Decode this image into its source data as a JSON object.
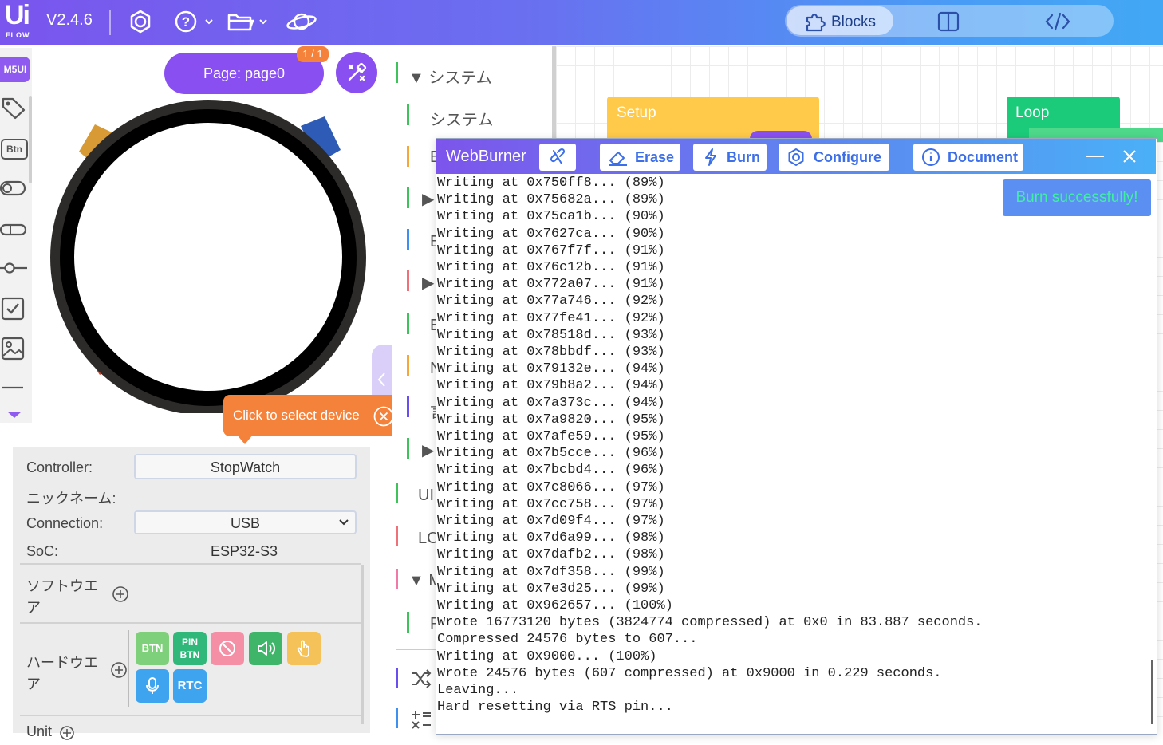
{
  "app": {
    "logo_text": "Ui",
    "logo_sub": "FLOW",
    "version": "V2.4.6",
    "mode_tabs": {
      "blocks": "Blocks"
    }
  },
  "toolbox": {
    "header": "M5UI",
    "btn_label": "Btn"
  },
  "preview": {
    "page_label": "Page: page0",
    "page_count": "1 / 1",
    "tooltip": "Click to select device"
  },
  "properties": {
    "controller_label": "Controller:",
    "controller_value": "StopWatch",
    "nickname_label": "ニックネーム:",
    "connection_label": "Connection:",
    "connection_value": "USB",
    "soc_label": "SoC:",
    "soc_value": "ESP32-S3",
    "software_label_1": "ソフトウエ",
    "software_label_2": "ア",
    "hardware_label_1": "ハードウエ",
    "hardware_label_2": "ア",
    "unit_label": "Unit",
    "hardware_items": [
      {
        "label": "BTN",
        "color": "#7fd07a"
      },
      {
        "label": "PIN BTN",
        "color": "#2fb87a"
      },
      {
        "label": "",
        "icon": "no-touch-icon",
        "color": "#f58fa5"
      },
      {
        "label": "",
        "icon": "speaker-icon",
        "color": "#3fb56a"
      },
      {
        "label": "",
        "icon": "touch-icon",
        "color": "#f5c25a"
      },
      {
        "label": "",
        "icon": "microphone-icon",
        "color": "#3fa4f0"
      },
      {
        "label": "RTC",
        "color": "#3fa4f0"
      }
    ]
  },
  "categories": [
    {
      "label": "▼ システム",
      "color": "#3fc25a"
    },
    {
      "label": "システム",
      "color": "#3fc25a"
    },
    {
      "label": "B",
      "color": "#f5a73a"
    },
    {
      "label": "▶",
      "color": "#3fc25a"
    },
    {
      "label": "E",
      "color": "#3f8ff0"
    },
    {
      "label": "▶",
      "color": "#f0707a"
    },
    {
      "label": "E",
      "color": "#3fc25a"
    },
    {
      "label": "N",
      "color": "#f5a73a"
    },
    {
      "label": "言",
      "color": "#6a4ff0"
    },
    {
      "label": "▶",
      "color": "#3fc25a"
    },
    {
      "label": "UI",
      "color": "#3fc25a"
    },
    {
      "label": "LC",
      "color": "#f0707a"
    },
    {
      "label": "▼ M",
      "color": "#f07aa5"
    },
    {
      "label": "P",
      "color": "#3fc25a"
    }
  ],
  "workspace": {
    "setup": "Setup",
    "loop": "Loop"
  },
  "webburner": {
    "title": "WebBurner",
    "erase": "Erase",
    "burn": "Burn",
    "configure": "Configure",
    "document": "Document",
    "toast": "Burn successfully!",
    "log": [
      "Writing at 0x750ff8... (89%)",
      "Writing at 0x75682a... (89%)",
      "Writing at 0x75ca1b... (90%)",
      "Writing at 0x7627ca... (90%)",
      "Writing at 0x767f7f... (91%)",
      "Writing at 0x76c12b... (91%)",
      "Writing at 0x772a07... (91%)",
      "Writing at 0x77a746... (92%)",
      "Writing at 0x77fe41... (92%)",
      "Writing at 0x78518d... (93%)",
      "Writing at 0x78bbdf... (93%)",
      "Writing at 0x79132e... (94%)",
      "Writing at 0x79b8a2... (94%)",
      "Writing at 0x7a373c... (94%)",
      "Writing at 0x7a9820... (95%)",
      "Writing at 0x7afe59... (95%)",
      "Writing at 0x7b5cce... (96%)",
      "Writing at 0x7bcbd4... (96%)",
      "Writing at 0x7c8066... (97%)",
      "Writing at 0x7cc758... (97%)",
      "Writing at 0x7d09f4... (97%)",
      "Writing at 0x7d6a99... (98%)",
      "Writing at 0x7dafb2... (98%)",
      "Writing at 0x7df358... (99%)",
      "Writing at 0x7e3d25... (99%)",
      "Writing at 0x962657... (100%)",
      "Wrote 16773120 bytes (3824774 compressed) at 0x0 in 83.887 seconds.",
      "Compressed 24576 bytes to 607...",
      "Writing at 0x9000... (100%)",
      "Wrote 24576 bytes (607 compressed) at 0x9000 in 0.229 seconds.",
      "Leaving...",
      "Hard resetting via RTS pin..."
    ]
  }
}
